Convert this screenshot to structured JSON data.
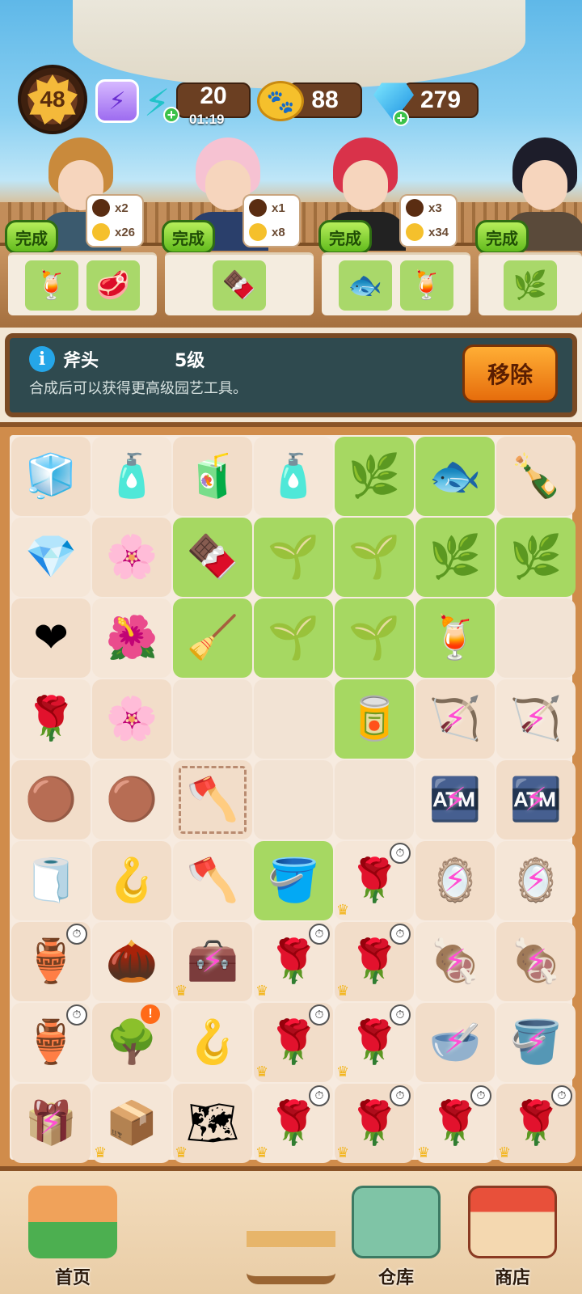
{
  "hud": {
    "player_level": "48",
    "energy_count": "20",
    "energy_timer": "01:19",
    "paw_count": "88",
    "gem_count": "279",
    "colors": {
      "energy": "#21c3c9",
      "paw": "#f5c02c",
      "gem": "#1a8fe0"
    }
  },
  "orders": [
    {
      "reward_1": "x2",
      "reward_2": "x26",
      "done_label": "完成",
      "items": [
        "watermelon-juice",
        "meat-bucket"
      ]
    },
    {
      "reward_1": "x1",
      "reward_2": "x8",
      "done_label": "完成",
      "items": [
        "chocolate"
      ]
    },
    {
      "reward_1": "x3",
      "reward_2": "x34",
      "done_label": "完成",
      "items": [
        "fish",
        "watermelon-juice"
      ]
    },
    {
      "done_label": "完成",
      "items": [
        "plant"
      ]
    }
  ],
  "info": {
    "item_name": "斧头",
    "item_level": "5级",
    "description": "合成后可以获得更高级园艺工具。",
    "remove_label": "移除"
  },
  "board": [
    [
      {
        "icon": "🧊"
      },
      {
        "icon": "🧴"
      },
      {
        "icon": "🧃"
      },
      {
        "icon": "🧴"
      },
      {
        "icon": "🌿",
        "green": true
      },
      {
        "icon": "🐟",
        "green": true
      },
      {
        "icon": "🍾"
      }
    ],
    [
      {
        "icon": "💎"
      },
      {
        "icon": "🌸"
      },
      {
        "icon": "🍫",
        "green": true
      },
      {
        "icon": "🌱",
        "green": true
      },
      {
        "icon": "🌱",
        "green": true
      },
      {
        "icon": "🌿",
        "green": true
      },
      {
        "icon": "🌿",
        "green": true
      }
    ],
    [
      {
        "icon": "❤"
      },
      {
        "icon": "🌺"
      },
      {
        "icon": "🧹",
        "green": true
      },
      {
        "icon": "🌱",
        "green": true
      },
      {
        "icon": "🌱",
        "green": true
      },
      {
        "icon": "🍹",
        "green": true
      },
      {
        "icon": ""
      }
    ],
    [
      {
        "icon": "🌹"
      },
      {
        "icon": "🌸"
      },
      {
        "icon": ""
      },
      {
        "icon": ""
      },
      {
        "icon": "🥫",
        "green": true
      },
      {
        "icon": "🏹",
        "locked": true
      },
      {
        "icon": "🏹",
        "locked": true
      }
    ],
    [
      {
        "icon": "🟤"
      },
      {
        "icon": "🟤"
      },
      {
        "icon": "🪓",
        "selected": true
      },
      {
        "icon": ""
      },
      {
        "icon": ""
      },
      {
        "icon": "🏧",
        "locked": true
      },
      {
        "icon": "🏧",
        "locked": true
      }
    ],
    [
      {
        "icon": "🧻"
      },
      {
        "icon": "🪝"
      },
      {
        "icon": "🪓"
      },
      {
        "icon": "🪣",
        "green": true
      },
      {
        "icon": "🌹",
        "timer": true,
        "crown": true
      },
      {
        "icon": "🪞",
        "locked": true
      },
      {
        "icon": "🪞",
        "locked": true
      }
    ],
    [
      {
        "icon": "🏺",
        "timer": true
      },
      {
        "icon": "🌰"
      },
      {
        "icon": "🧰",
        "locked": true,
        "crown": true
      },
      {
        "icon": "🌹",
        "timer": true,
        "crown": true
      },
      {
        "icon": "🌹",
        "timer": true,
        "crown": true
      },
      {
        "icon": "🍖",
        "locked": true
      },
      {
        "icon": "🍖",
        "locked": true
      }
    ],
    [
      {
        "icon": "🏺",
        "timer": true
      },
      {
        "icon": "🌳",
        "alert": true
      },
      {
        "icon": "🪝"
      },
      {
        "icon": "🌹",
        "timer": true,
        "crown": true
      },
      {
        "icon": "🌹",
        "timer": true,
        "crown": true
      },
      {
        "icon": "🥣",
        "locked": true
      },
      {
        "icon": "🪣",
        "locked": true
      }
    ],
    [
      {
        "icon": "🎁",
        "locked": true
      },
      {
        "icon": "📦",
        "crown": true
      },
      {
        "icon": "🗺",
        "crown": true
      },
      {
        "icon": "🌹",
        "timer": true,
        "crown": true
      },
      {
        "icon": "🌹",
        "timer": true,
        "crown": true
      },
      {
        "icon": "🌹",
        "timer": true,
        "crown": true
      },
      {
        "icon": "🌹",
        "timer": true,
        "crown": true
      }
    ]
  ],
  "nav": {
    "home_label": "首页",
    "storage_label": "仓库",
    "shop_label": "商店"
  }
}
